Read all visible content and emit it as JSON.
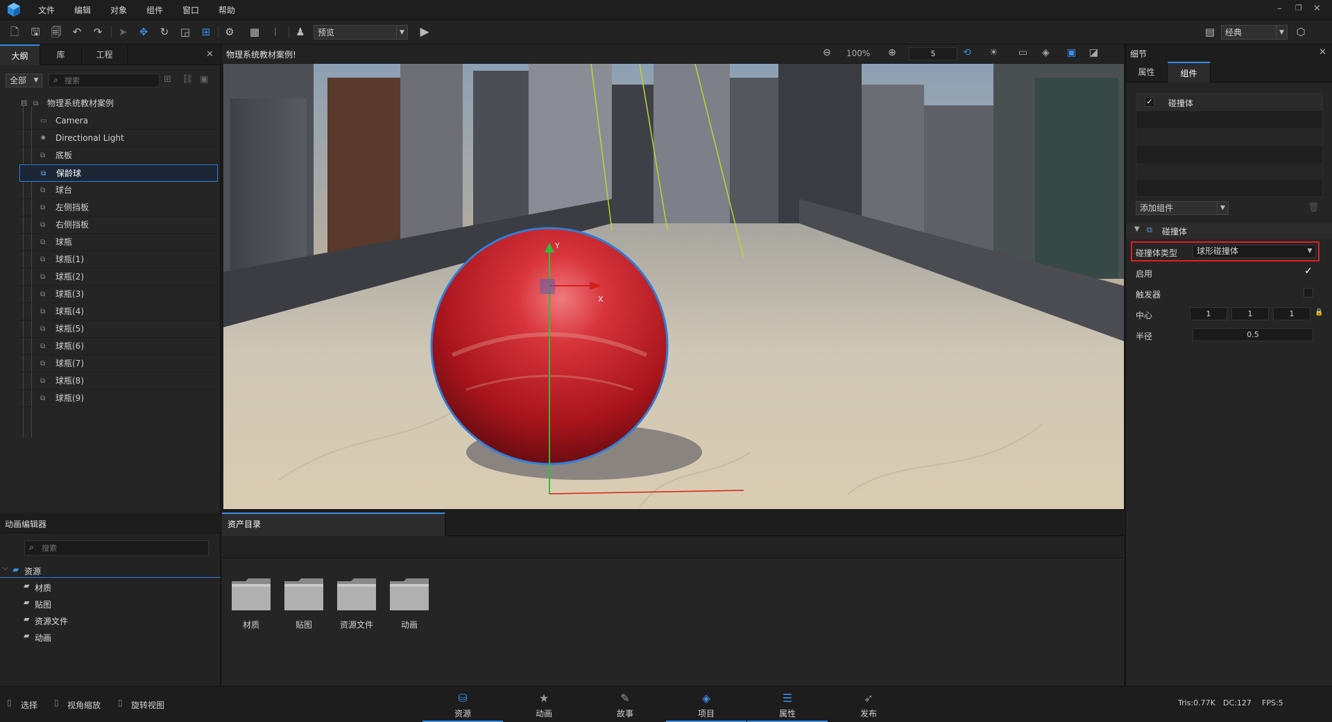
{
  "menu": {
    "items": [
      "文件",
      "编辑",
      "对象",
      "组件",
      "窗口",
      "帮助"
    ]
  },
  "toolbar": {
    "preview_label": "预览",
    "layout_label": "经典"
  },
  "outline": {
    "tabs": [
      "大纲",
      "库",
      "工程"
    ],
    "filter_label": "全部",
    "search_placeholder": "搜索",
    "root": "物理系统教材案例",
    "items": [
      "Camera",
      "Directional Light",
      "底板",
      "保龄球",
      "球台",
      "左侧挡板",
      "右侧挡板",
      "球瓶",
      "球瓶(1)",
      "球瓶(2)",
      "球瓶(3)",
      "球瓶(4)",
      "球瓶(5)",
      "球瓶(6)",
      "球瓶(7)",
      "球瓶(8)",
      "球瓶(9)"
    ],
    "selected": "保龄球"
  },
  "viewport": {
    "title": "物理系统教材案例!",
    "zoom": "100%",
    "speed": "5",
    "axis_y": "Y",
    "axis_x": "X"
  },
  "details": {
    "title": "细节",
    "tabs": [
      "属性",
      "组件"
    ],
    "component_item": "碰撞体",
    "add_component": "添加组件",
    "section": "碰撞体",
    "collider_type_label": "碰撞体类型",
    "collider_type_value": "球形碰撞体",
    "enabled_label": "启用",
    "trigger_label": "触发器",
    "center_label": "中心",
    "center": [
      "1",
      "1",
      "1"
    ],
    "radius_label": "半径",
    "radius": "0.5"
  },
  "anim": {
    "title": "动画编辑器",
    "search_placeholder": "搜索",
    "root": "资源",
    "children": [
      "材质",
      "贴图",
      "资源文件",
      "动画"
    ]
  },
  "assets": {
    "tab": "资产目录",
    "folders": [
      "材质",
      "贴图",
      "资源文件",
      "动画"
    ]
  },
  "status": {
    "modes": [
      "选择",
      "视角缩放",
      "旋转视图"
    ],
    "tabs": [
      "资源",
      "动画",
      "故事",
      "项目",
      "属性",
      "发布"
    ],
    "tris": "Tris:0.77K",
    "dc": "DC:127",
    "fps": "FPS:5"
  },
  "colors": {
    "accent": "#3a8fe8",
    "ball": "#c4242c",
    "highlight": "#e02020"
  }
}
